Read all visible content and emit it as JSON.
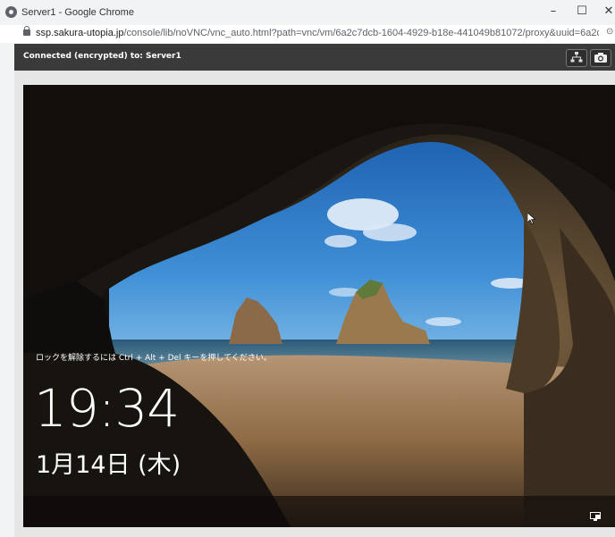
{
  "window": {
    "title": "Server1 - Google Chrome",
    "minimize": "–",
    "maximize": "☐",
    "close": "✕"
  },
  "address": {
    "host": "ssp.sakura-utopia.jp",
    "path": "/console/lib/noVNC/vnc_auto.html?path=vnc/vm/6a2c7dcb-1604-4929-b18e-441049b81072/proxy&uuid=6a2c7dcb-16..."
  },
  "vnc": {
    "status": "Connected (encrypted) to: Server1"
  },
  "lockscreen": {
    "hint": "ロックを解除するには Ctrl + Alt + Del キーを押してください。",
    "time": "19:34",
    "date": "1月14日 (木)"
  },
  "icons": {
    "browser": "chrome-icon",
    "lock": "lock-icon",
    "network_button": "network-tree-icon",
    "screenshot_button": "camera-icon",
    "tray": "network-icon",
    "pointer": "mouse-cursor-icon"
  }
}
